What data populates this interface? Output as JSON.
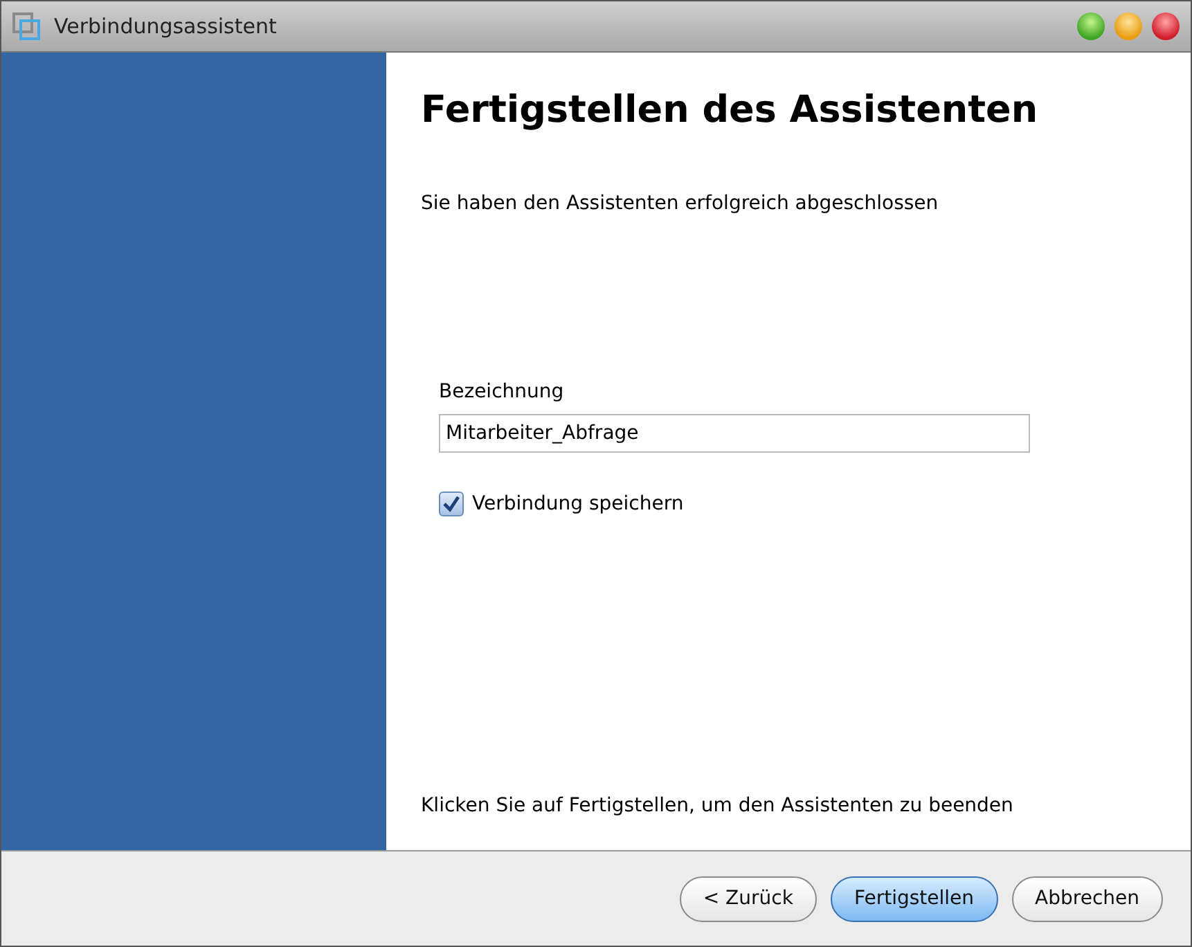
{
  "window": {
    "title": "Verbindungsassistent"
  },
  "page": {
    "heading": "Fertigstellen des Assistenten",
    "intro": "Sie haben den Assistenten erfolgreich abgeschlossen",
    "footer_text": "Klicken Sie auf Fertigstellen, um den Assistenten zu beenden"
  },
  "name_field": {
    "label": "Bezeichnung",
    "value": "Mitarbeiter_Abfrage"
  },
  "save_checkbox": {
    "label": "Verbindung speichern",
    "checked": true
  },
  "buttons": [
    {
      "label": "< Zurück",
      "default": false
    },
    {
      "label": "Fertigstellen",
      "default": true
    },
    {
      "label": "Abbrechen",
      "default": false
    }
  ]
}
